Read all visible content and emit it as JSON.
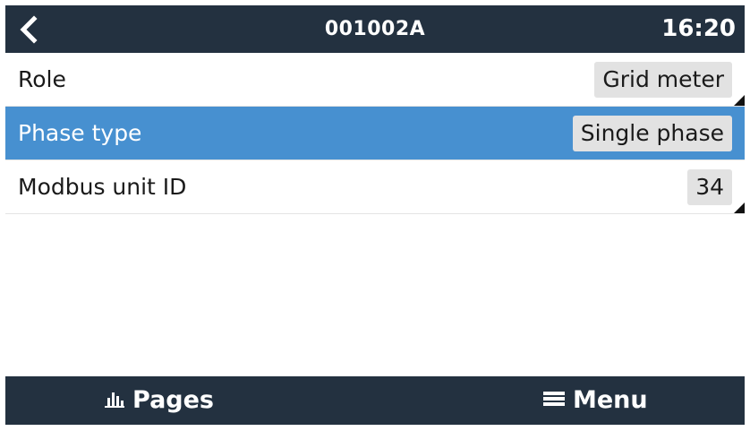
{
  "header": {
    "back_icon": "chevron-left-icon",
    "title": "001002A",
    "time": "16:20"
  },
  "settings": {
    "rows": [
      {
        "label": "Role",
        "value": "Grid meter",
        "selected": false,
        "editable": true
      },
      {
        "label": "Phase type",
        "value": "Single phase",
        "selected": true,
        "editable": false
      },
      {
        "label": "Modbus unit ID",
        "value": "34",
        "selected": false,
        "editable": true
      }
    ]
  },
  "footer": {
    "pages_icon": "bar-chart-icon",
    "pages_label": "Pages",
    "menu_icon": "hamburger-menu-icon",
    "menu_label": "Menu"
  },
  "colors": {
    "header_bg": "#233140",
    "selected_row_bg": "#4790d0",
    "value_chip_bg": "#e2e2e2"
  }
}
